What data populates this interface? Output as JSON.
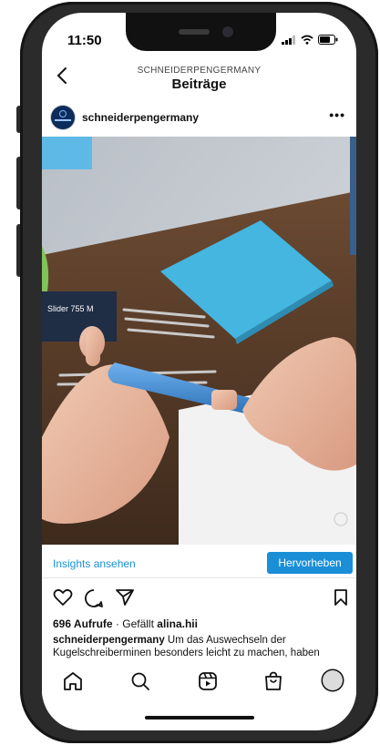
{
  "status": {
    "time": "11:50"
  },
  "header": {
    "account_caps": "SCHNEIDERPENGERMANY",
    "title": "Beiträge"
  },
  "post": {
    "username": "schneiderpengermany",
    "avatar_brand": "Schneider",
    "media_label": "Slider 755 M",
    "insights_label": "Insights ansehen",
    "highlight_label": "Hervorheben",
    "views": "696 Aufrufe",
    "liked_by_prefix": "· Gefällt",
    "liked_by_user": "alina.hii",
    "caption_user": "schneiderpengermany",
    "caption_text": "Um das Auswechseln der Kugelschreiberminen besonders leicht zu machen, haben"
  },
  "nav": [
    "home-icon",
    "search-icon",
    "reels-icon",
    "shop-icon",
    "profile-avatar"
  ],
  "colors": {
    "accent": "#1a8fd8",
    "sticky_note": "#44b6e0",
    "pen": "#3f8fd6"
  }
}
